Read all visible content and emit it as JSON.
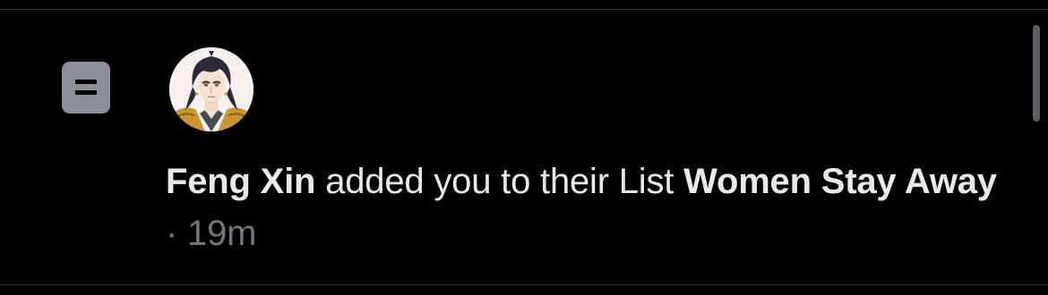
{
  "notification": {
    "type_icon": "list-icon",
    "avatar_icon": "avatar-anime-man-icon",
    "user_name": "Feng Xin",
    "action_text": " added you to their List ",
    "list_name": "Women Stay Away",
    "separator": " · ",
    "timestamp": "19m"
  },
  "colors": {
    "background": "#000000",
    "primary_text": "#e7e9ea",
    "secondary_text": "#71767b",
    "icon_bg": "#8b9097",
    "divider": "#2f3336"
  }
}
